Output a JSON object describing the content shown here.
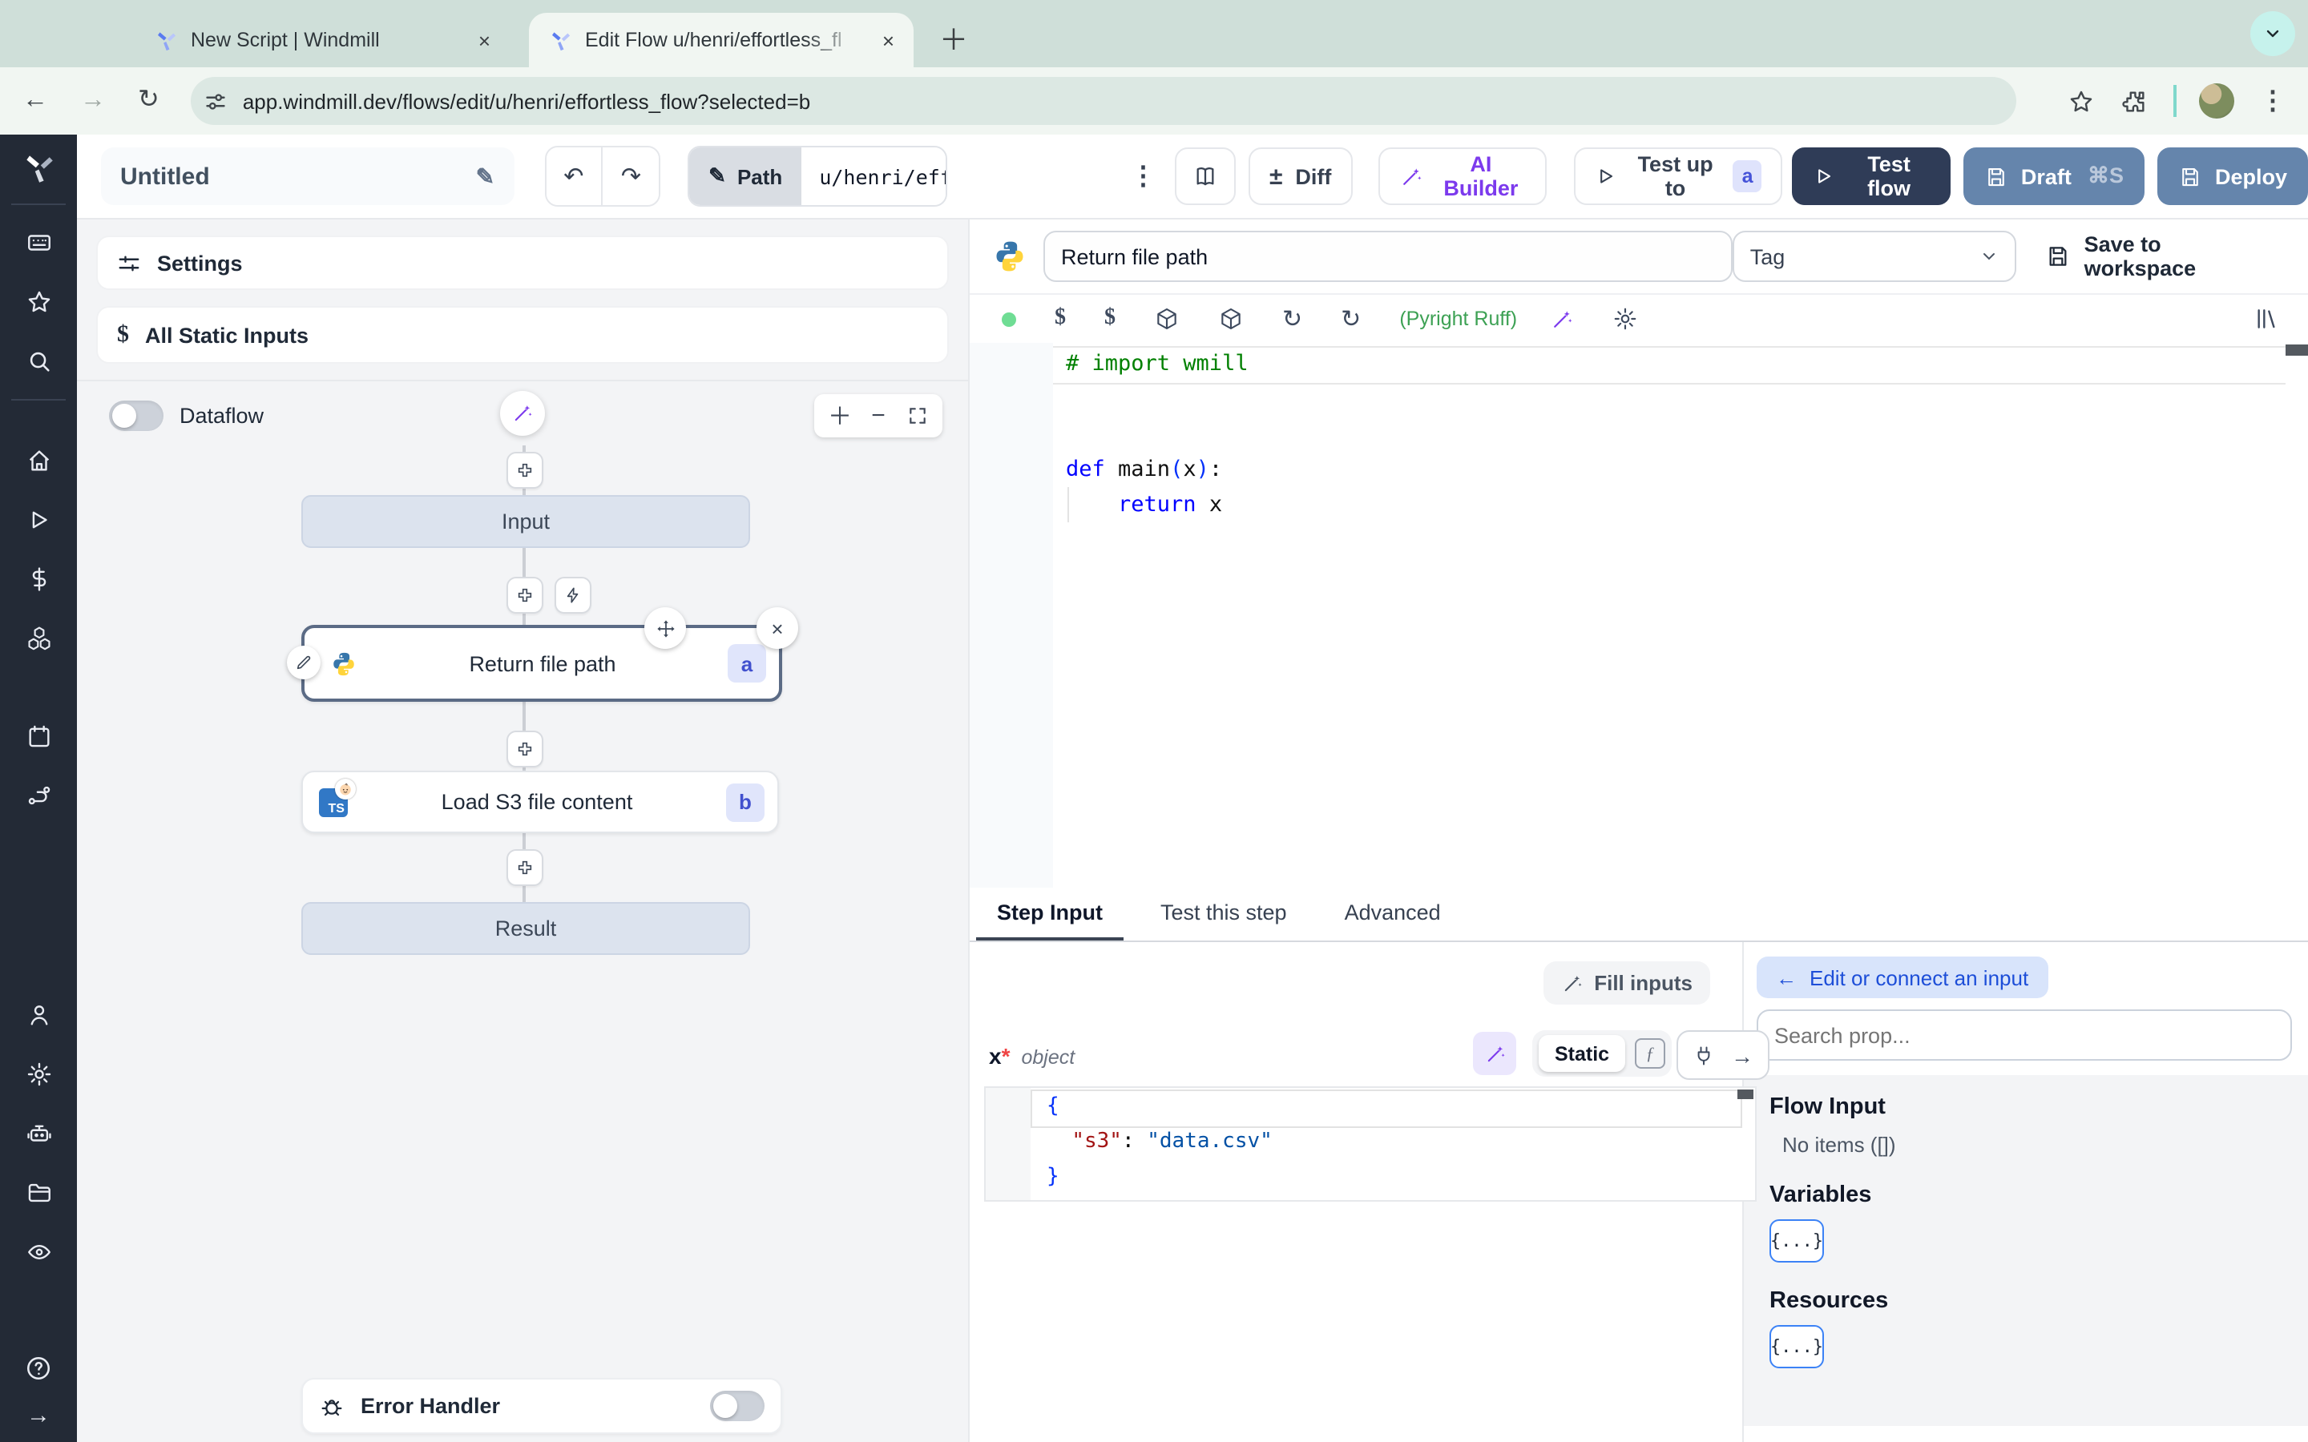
{
  "browser": {
    "tabs": [
      {
        "title": "New Script | Windmill"
      },
      {
        "title": "Edit Flow u/henri/effortless_fl"
      }
    ],
    "url": "app.windmill.dev/flows/edit/u/henri/effortless_flow?selected=b"
  },
  "icons": {
    "kebab": "⋮",
    "undo": "↶",
    "redo": "↷",
    "close": "×",
    "back": "←",
    "forward": "→",
    "reload": "↻",
    "plus": "＋",
    "minus": "−",
    "plus_math": "±",
    "fn": "ƒ",
    "arrow_left": "←",
    "arrow_right": "→",
    "dollar": "$",
    "pencil": "✎"
  },
  "toolbar": {
    "flow_name": "Untitled",
    "path_label": "Path",
    "path_value": "u/henri/eff",
    "diff": "Diff",
    "ai_builder": "AI Builder",
    "test_up_to": "Test up to",
    "test_up_to_badge": "a",
    "test_flow": "Test flow",
    "draft": "Draft",
    "draft_shortcut": "⌘S",
    "deploy": "Deploy"
  },
  "left_panel": {
    "settings": "Settings",
    "all_static_inputs": "All Static Inputs",
    "dataflow": "Dataflow",
    "graph": {
      "input": "Input",
      "result": "Result",
      "steps": [
        {
          "label": "Return file path",
          "badge": "a"
        },
        {
          "label": "Load S3 file content",
          "badge": "b",
          "icon_text": "TS"
        }
      ],
      "error_handler": "Error Handler"
    }
  },
  "editor": {
    "step_name": "Return file path",
    "tag_placeholder": "Tag",
    "save_to_workspace": "Save to workspace",
    "lint": "(Pyright Ruff)",
    "code": {
      "comment": "# import wmill",
      "kw_def": "def",
      "fn_name": " main",
      "paren_open": "(",
      "arg": "x",
      "paren_close": ")",
      "colon": ":",
      "indent": "    ",
      "kw_return": "return",
      "ret_val": " x"
    }
  },
  "step_panel": {
    "tabs": [
      {
        "label": "Step Input"
      },
      {
        "label": "Test this step"
      },
      {
        "label": "Advanced"
      }
    ],
    "fill_inputs": "Fill inputs",
    "arg_name": "x",
    "arg_required": "*",
    "arg_type": "object",
    "static_label": "Static",
    "json": {
      "open": "{",
      "indent": "  ",
      "key": "\"s3\"",
      "colon": ": ",
      "value": "\"data.csv\"",
      "close": "}"
    }
  },
  "connect_panel": {
    "edit_connect": "Edit or connect an input",
    "search_placeholder": "Search prop...",
    "flow_input_title": "Flow Input",
    "flow_input_empty": "No items ([])",
    "variables_title": "Variables",
    "resources_title": "Resources",
    "braces_button": "{...}"
  },
  "colors": {
    "rail_bg": "#232a36",
    "chrome_tabstrip": "#cfdfd9",
    "chrome_toolbar": "#f1f6f2",
    "dark_button": "#2f3c57",
    "slate_button": "#6585ac",
    "accent_purple": "#7c3aed",
    "selected_node_border": "#5b6b85",
    "badge_bg": "#e0e5fb",
    "badge_text": "#4150ce",
    "virtual_node_bg": "#dce3ee",
    "panel_bg": "#f3f4f6",
    "lint_green": "#3da154",
    "connect_pill_bg": "#d8e4fb",
    "connect_pill_text": "#1d4ed8"
  }
}
